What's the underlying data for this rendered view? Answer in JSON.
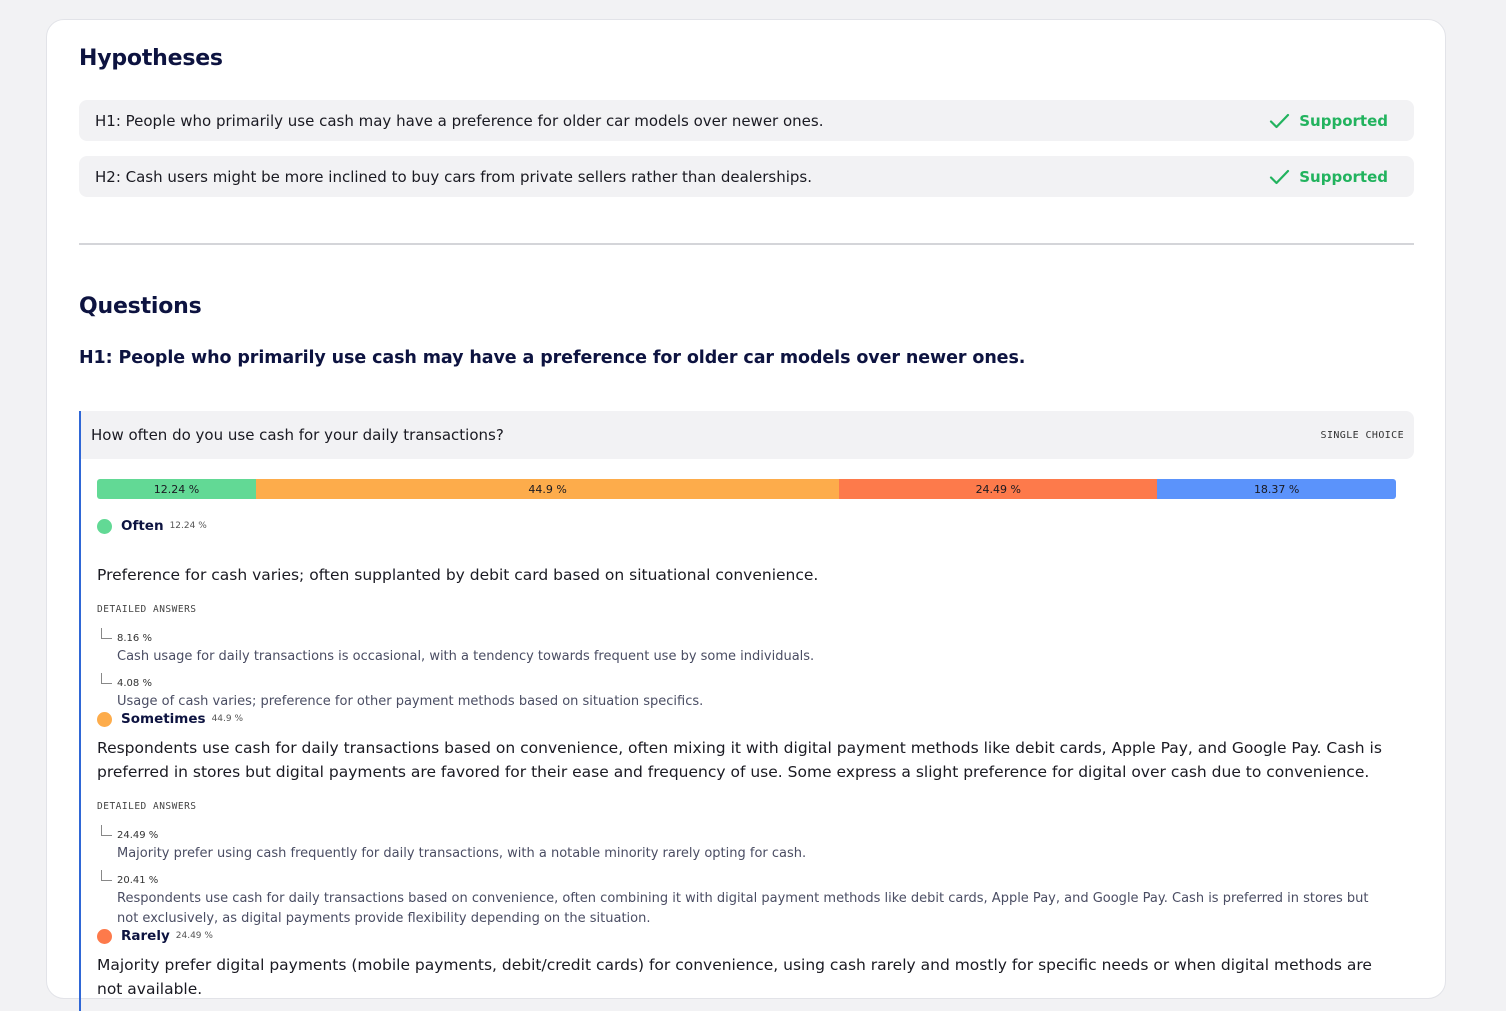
{
  "hypotheses": {
    "title": "Hypotheses",
    "items": [
      {
        "text": "H1: People who primarily use cash may have a preference for older car models over newer ones.",
        "status": "Supported"
      },
      {
        "text": "H2: Cash users might be more inclined to buy cars from private sellers rather than dealerships.",
        "status": "Supported"
      }
    ]
  },
  "questions": {
    "title": "Questions",
    "hypothesis_heading": "H1: People who primarily use cash may have a preference for older car models over newer ones.",
    "question": {
      "text": "How often do you use cash for your daily transactions?",
      "type": "SINGLE CHOICE",
      "distribution": [
        {
          "label": "12.24 %",
          "value": 12.24,
          "color": "#62d995"
        },
        {
          "label": "44.9 %",
          "value": 44.9,
          "color": "#fdac4b"
        },
        {
          "label": "24.49 %",
          "value": 24.49,
          "color": "#fd7a4b"
        },
        {
          "label": "18.37 %",
          "value": 18.37,
          "color": "#5b93fb"
        }
      ],
      "options": [
        {
          "name": "Often",
          "pct": "12.24 %",
          "color": "#62d995",
          "summary": "Preference for cash varies; often supplanted by debit card based on situational convenience.",
          "detailed_label": "DETAILED ANSWERS",
          "details": [
            {
              "pct": "8.16 %",
              "text": "Cash usage for daily transactions is occasional, with a tendency towards frequent use by some individuals."
            },
            {
              "pct": "4.08 %",
              "text": "Usage of cash varies; preference for other payment methods based on situation specifics."
            }
          ]
        },
        {
          "name": "Sometimes",
          "pct": "44.9 %",
          "color": "#fdac4b",
          "summary": "Respondents use cash for daily transactions based on convenience, often mixing it with digital payment methods like debit cards, Apple Pay, and Google Pay. Cash is preferred in stores but digital payments are favored for their ease and frequency of use. Some express a slight preference for digital over cash due to convenience.",
          "detailed_label": "DETAILED ANSWERS",
          "details": [
            {
              "pct": "24.49 %",
              "text": "Majority prefer using cash frequently for daily transactions, with a notable minority rarely opting for cash."
            },
            {
              "pct": "20.41 %",
              "text": "Respondents use cash for daily transactions based on convenience, often combining it with digital payment methods like debit cards, Apple Pay, and Google Pay. Cash is preferred in stores but not exclusively, as digital payments provide flexibility depending on the situation."
            }
          ]
        },
        {
          "name": "Rarely",
          "pct": "24.49 %",
          "color": "#fd7a4b",
          "summary": "Majority prefer digital payments (mobile payments, debit/credit cards) for convenience, using cash rarely and mostly for specific needs or when digital methods are not available."
        }
      ]
    }
  }
}
